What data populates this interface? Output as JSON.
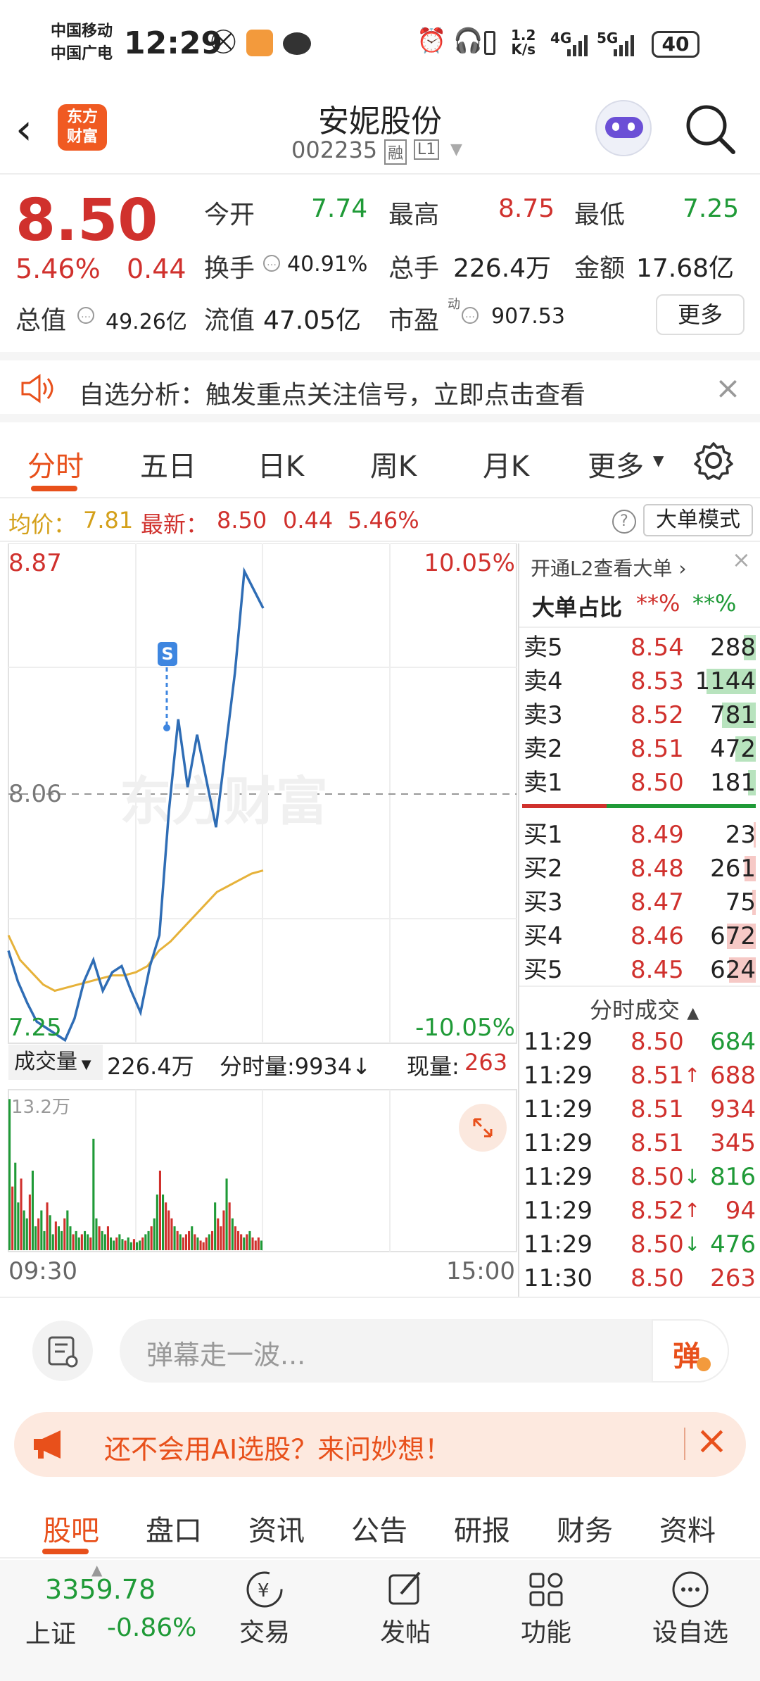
{
  "status": {
    "carrier1": "中国移动",
    "carrier2": "中国广电",
    "time": "12:29",
    "speed_top": "1.2",
    "speed_unit": "K/s",
    "net1": "4G",
    "net2": "5G",
    "battery": "40"
  },
  "header": {
    "logo_line1": "东方",
    "logo_line2": "财富",
    "stock_name": "安妮股份",
    "stock_code": "002235",
    "tag1": "融",
    "tag2": "L1"
  },
  "quote": {
    "price": "8.50",
    "change_pct": "5.46%",
    "change": "0.44",
    "open_label": "今开",
    "open": "7.74",
    "high_label": "最高",
    "high": "8.75",
    "low_label": "最低",
    "low": "7.25",
    "turnover_label": "换手",
    "turnover": "40.91%",
    "volume_label": "总手",
    "volume": "226.4万",
    "amount_label": "金额",
    "amount": "17.68亿",
    "mktcap_label": "总值",
    "mktcap": "49.26亿",
    "float_label": "流值",
    "float": "47.05亿",
    "pe_label": "市盈",
    "pe_sup": "动",
    "pe": "907.53",
    "more": "更多"
  },
  "notice": {
    "text": "自选分析：触发重点关注信号，立即点击查看"
  },
  "chart_tabs": [
    "分时",
    "五日",
    "日K",
    "周K",
    "月K",
    "更多"
  ],
  "infobar": {
    "avg_label": "均价：",
    "avg": "7.81",
    "latest_label": "最新：",
    "latest": "8.50",
    "chg": "0.44",
    "chg_pct": "5.46%",
    "mode": "大单模式"
  },
  "chart_labels": {
    "top_price": "8.87",
    "mid_price": "8.06",
    "bottom_price": "7.25",
    "top_pct": "10.05%",
    "bottom_pct": "-10.05%",
    "marker": "S",
    "watermark": "东方财富",
    "vol_select": "成交量",
    "vol_total": "226.4万",
    "fs_vol": "分时量:9934↓",
    "now_vol_label": "现量:",
    "now_vol": "263",
    "vol_max": "13.2万",
    "time_start": "09:30",
    "time_end": "15:00"
  },
  "chart_data": {
    "type": "line",
    "ylim": [
      7.25,
      8.87
    ],
    "series": [
      {
        "values": [
          7.55,
          7.45,
          7.38,
          7.32,
          7.3,
          7.28,
          7.26,
          7.33,
          7.45,
          7.52,
          7.42,
          7.48,
          7.5,
          7.42,
          7.35,
          7.5,
          7.6,
          8.0,
          8.3,
          8.08,
          8.25,
          8.1,
          7.95,
          8.2,
          8.45,
          8.78,
          8.72,
          8.66
        ]
      },
      {
        "values": [
          7.6,
          7.52,
          7.48,
          7.44,
          7.42,
          7.43,
          7.44,
          7.45,
          7.46,
          7.47,
          7.47,
          7.48,
          7.5,
          7.55,
          7.58,
          7.62,
          7.66,
          7.7,
          7.74,
          7.76,
          7.78,
          7.8,
          7.81
        ]
      }
    ]
  },
  "orderbook": {
    "l2_link": "开通L2查看大单",
    "big_label": "大单占比",
    "big_val1": "**%",
    "big_val2": "**%",
    "asks": [
      {
        "label": "卖5",
        "price": "8.54",
        "vol": "288",
        "bar": 0.25
      },
      {
        "label": "卖4",
        "price": "8.53",
        "vol": "1144",
        "bar": 1.0
      },
      {
        "label": "卖3",
        "price": "8.52",
        "vol": "781",
        "bar": 0.68
      },
      {
        "label": "卖2",
        "price": "8.51",
        "vol": "472",
        "bar": 0.41
      },
      {
        "label": "卖1",
        "price": "8.50",
        "vol": "181",
        "bar": 0.16
      }
    ],
    "bids": [
      {
        "label": "买1",
        "price": "8.49",
        "vol": "23",
        "bar": 0.02
      },
      {
        "label": "买2",
        "price": "8.48",
        "vol": "261",
        "bar": 0.23
      },
      {
        "label": "买3",
        "price": "8.47",
        "vol": "75",
        "bar": 0.07
      },
      {
        "label": "买4",
        "price": "8.46",
        "vol": "672",
        "bar": 0.59
      },
      {
        "label": "买5",
        "price": "8.45",
        "vol": "624",
        "bar": 0.55
      }
    ],
    "trades_title": "分时成交",
    "trades": [
      {
        "time": "11:29",
        "price": "8.50",
        "arrow": "",
        "vol": "684",
        "vcolor": "green"
      },
      {
        "time": "11:29",
        "price": "8.51",
        "arrow": "↑",
        "vol": "688",
        "vcolor": "red"
      },
      {
        "time": "11:29",
        "price": "8.51",
        "arrow": "",
        "vol": "934",
        "vcolor": "red"
      },
      {
        "time": "11:29",
        "price": "8.51",
        "arrow": "",
        "vol": "345",
        "vcolor": "red"
      },
      {
        "time": "11:29",
        "price": "8.50",
        "arrow": "↓",
        "vol": "816",
        "vcolor": "green"
      },
      {
        "time": "11:29",
        "price": "8.52",
        "arrow": "↑",
        "vol": "94",
        "vcolor": "red"
      },
      {
        "time": "11:29",
        "price": "8.50",
        "arrow": "↓",
        "vol": "476",
        "vcolor": "green"
      },
      {
        "time": "11:30",
        "price": "8.50",
        "arrow": "",
        "vol": "263",
        "vcolor": "red"
      }
    ]
  },
  "comment": {
    "placeholder": "弹幕走一波...",
    "send": "弹"
  },
  "ad": {
    "text": "还不会用AI选股？来问妙想！"
  },
  "bottom_tabs": [
    "股吧",
    "盘口",
    "资讯",
    "公告",
    "研报",
    "财务",
    "资料"
  ],
  "bottom_nav": {
    "index_value": "3359.78",
    "index_name": "上证",
    "index_chg": "-0.86%",
    "items": [
      "交易",
      "发帖",
      "功能",
      "设自选"
    ]
  },
  "colors": {
    "up": "#d0312d",
    "down": "#1f9a37",
    "accent": "#e8501b",
    "line": "#2f6db5",
    "avg": "#e6b23a"
  }
}
